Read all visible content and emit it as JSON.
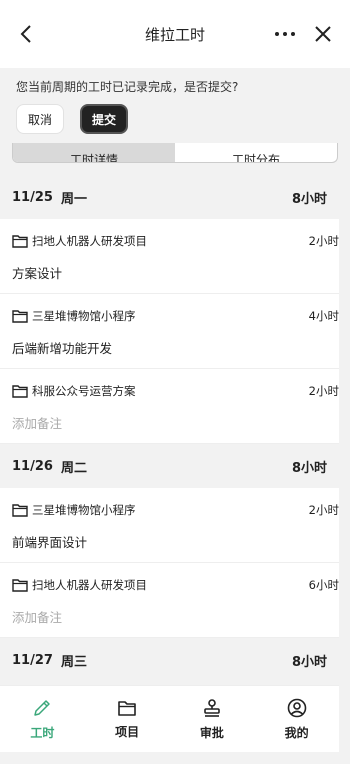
{
  "titlebar": {
    "title": "维拉工时"
  },
  "banner": {
    "message": "您当前周期的工时已记录完成，是否提交?",
    "cancel_label": "取消",
    "submit_label": "提交"
  },
  "tabs": [
    {
      "label": "工时详情",
      "active": true
    },
    {
      "label": "工时分布",
      "active": false
    }
  ],
  "days": [
    {
      "date": "11/25",
      "weekday": "周一",
      "hours": "8小时",
      "entries": [
        {
          "project": "扫地人机器人研发项目",
          "hours": "2小时",
          "note": "方案设计",
          "placeholder": false
        },
        {
          "project": "三星堆博物馆小程序",
          "hours": "4小时",
          "note": "后端新增功能开发",
          "placeholder": false
        },
        {
          "project": "科服公众号运营方案",
          "hours": "2小时",
          "note": "添加备注",
          "placeholder": true
        }
      ]
    },
    {
      "date": "11/26",
      "weekday": "周二",
      "hours": "8小时",
      "entries": [
        {
          "project": "三星堆博物馆小程序",
          "hours": "2小时",
          "note": "前端界面设计",
          "placeholder": false
        },
        {
          "project": "扫地人机器人研发项目",
          "hours": "6小时",
          "note": "添加备注",
          "placeholder": true
        }
      ]
    },
    {
      "date": "11/27",
      "weekday": "周三",
      "hours": "8小时",
      "entries": []
    }
  ],
  "bottomnav": [
    {
      "label": "工时",
      "icon": "pencil-icon",
      "active": true
    },
    {
      "label": "项目",
      "icon": "folder-icon",
      "active": false
    },
    {
      "label": "审批",
      "icon": "stamp-icon",
      "active": false
    },
    {
      "label": "我的",
      "icon": "user-circle-icon",
      "active": false
    }
  ],
  "colors": {
    "accent": "#3aa77a",
    "dark_button": "#222222",
    "background": "#f2f2f2"
  }
}
